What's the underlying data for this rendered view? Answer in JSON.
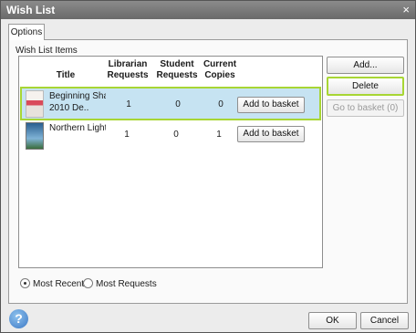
{
  "window": {
    "title": "Wish List",
    "close_glyph": "×"
  },
  "tabs": [
    {
      "label": "Options"
    }
  ],
  "section_label": "Wish List Items",
  "columns": {
    "title": "Title",
    "librarian_requests": "Librarian Requests",
    "student_requests": "Student Requests",
    "current_copies": "Current Copies"
  },
  "rows": [
    {
      "title_line1": "Beginning Sha",
      "title_line2": "2010 De..",
      "librarian_requests": "1",
      "student_requests": "0",
      "current_copies": "0",
      "action_label": "Add to basket"
    },
    {
      "title_line1": "Northern Light",
      "title_line2": "",
      "librarian_requests": "1",
      "student_requests": "0",
      "current_copies": "1",
      "action_label": "Add to basket"
    }
  ],
  "side_buttons": {
    "add": "Add...",
    "delete": "Delete",
    "go_to_basket": "Go to basket (0)"
  },
  "sort_options": {
    "most_recent": "Most Recent",
    "most_requests": "Most Requests",
    "selected": "Most Recent"
  },
  "footer": {
    "ok": "OK",
    "cancel": "Cancel",
    "help_glyph": "?"
  }
}
